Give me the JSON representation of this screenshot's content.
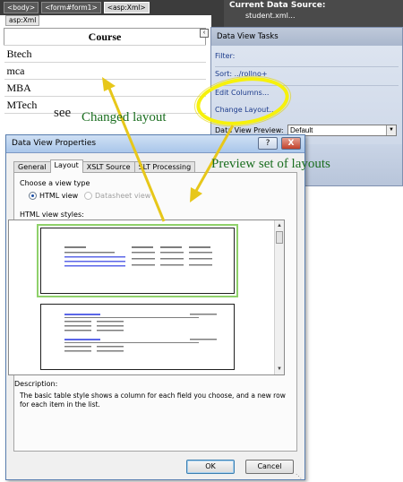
{
  "tagbar": {
    "tags": [
      "<body>",
      "<form#form1>",
      "<asp:Xml>"
    ]
  },
  "xml_label": "asp:Xml",
  "data_source": {
    "title": "Current Data Source:",
    "value": "student.xml..."
  },
  "course_table": {
    "header": "Course",
    "rows": [
      "Btech",
      "mca",
      "MBA",
      "MTech"
    ]
  },
  "tasks": {
    "title": "Data View Tasks",
    "filter": "Filter:",
    "sort": "Sort: ../rollno+",
    "edit_columns": "Edit Columns...",
    "change_layout": "Change Layout...",
    "preview_label": "Data View Preview:",
    "preview_value": "Default"
  },
  "dialog": {
    "title": "Data View Properties",
    "help": "?",
    "close": "X",
    "tabs": [
      "General",
      "Layout",
      "XSLT Source",
      "SLT Processing"
    ],
    "view_type_label": "Choose a view type",
    "radio_html": "HTML view",
    "radio_datasheet": "Datasheet view",
    "styles_label": "HTML view styles:",
    "description_label": "Description:",
    "description": "The basic table style shows a column for each field you choose, and a new row for each item in the list.",
    "ok": "OK",
    "cancel": "Cancel"
  },
  "annotations": {
    "see": "see",
    "changed": "Changed layout",
    "preview": "Preview set of layouts"
  },
  "colors": {
    "annotation_green": "#1b6e20",
    "highlight_yellow": "#f6f10c",
    "arrow_yellow": "#e7c71a",
    "selection_green": "#8fd16a"
  },
  "icons": {
    "smart_tag": "chevron-left-icon",
    "dropdown": "chevron-down-icon",
    "resize": "resize-grip-icon"
  }
}
